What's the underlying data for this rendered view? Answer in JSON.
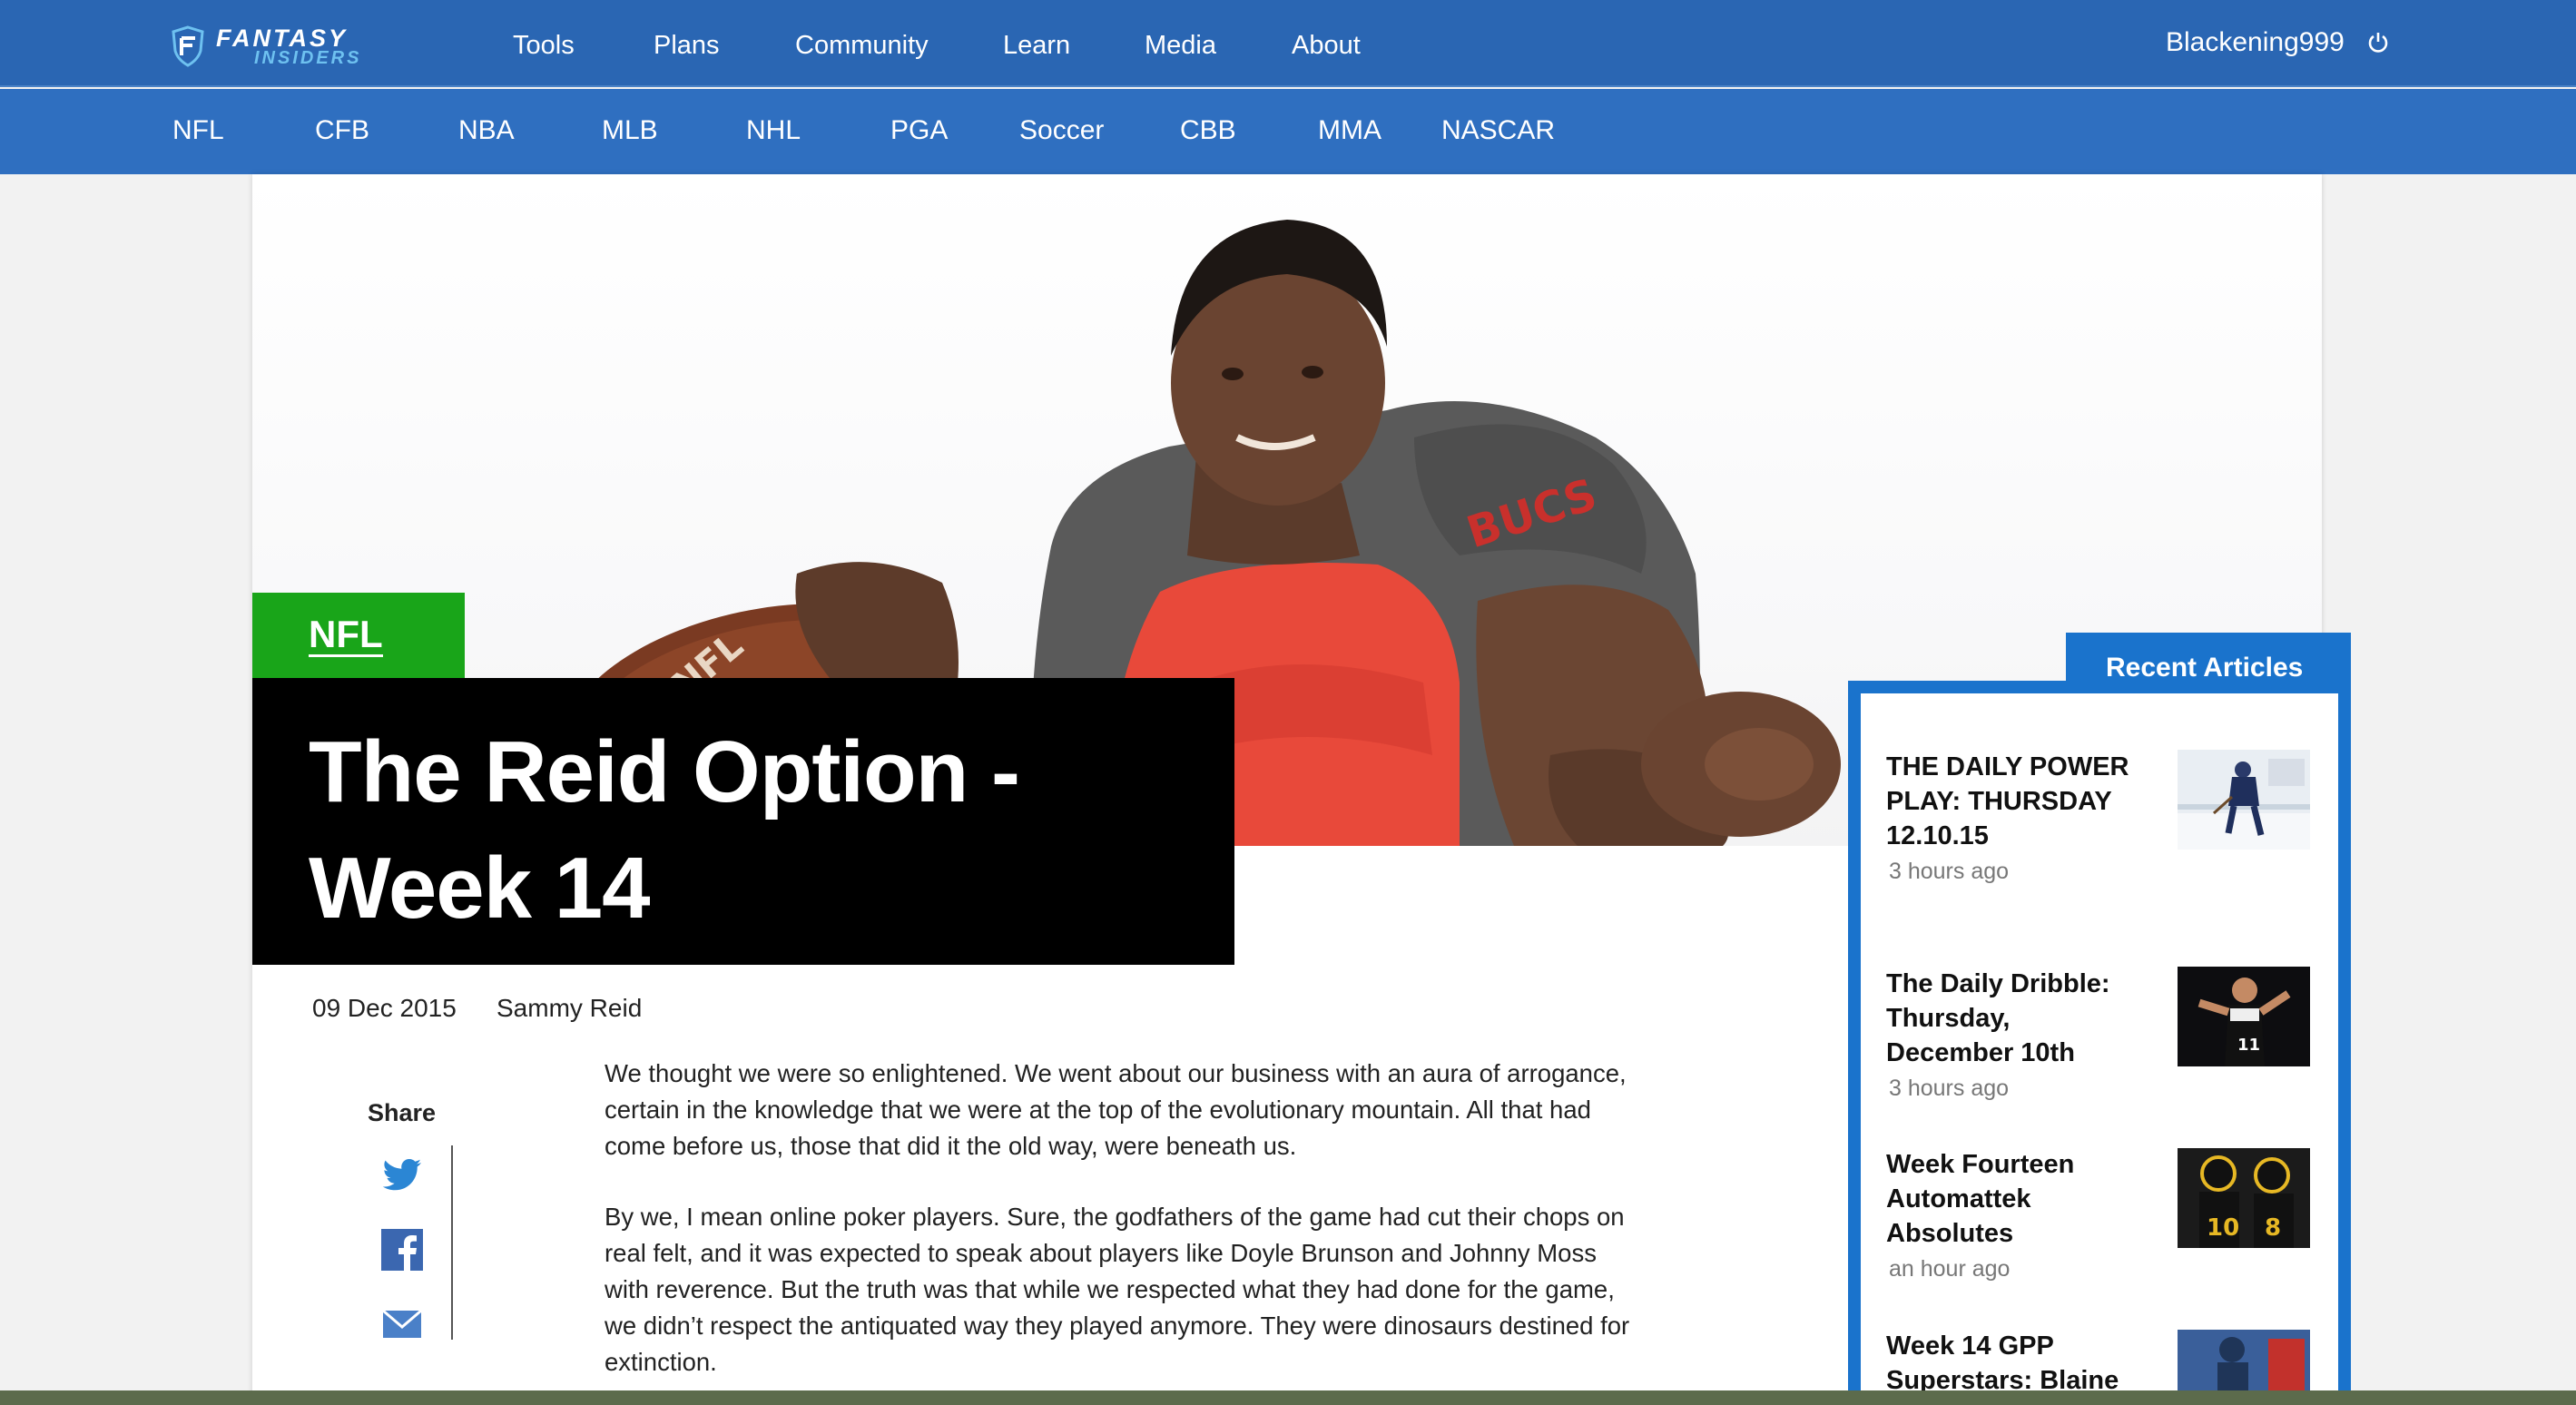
{
  "header": {
    "logo_line1": "FANTASY",
    "logo_line2": "INSIDERS",
    "nav": [
      "Tools",
      "Plans",
      "Community",
      "Learn",
      "Media",
      "About"
    ],
    "username": "Blackening999"
  },
  "sports_nav": [
    "NFL",
    "CFB",
    "NBA",
    "MLB",
    "NHL",
    "PGA",
    "Soccer",
    "CBB",
    "MMA",
    "NASCAR"
  ],
  "article": {
    "category": "NFL",
    "title": "The Reid Option - Week 14",
    "date": "09 Dec 2015",
    "author": "Sammy Reid",
    "share_label": "Share",
    "paragraphs": [
      "We thought we were so enlightened. We went about our business with an aura of arrogance, certain in the knowledge that we were at the top of the evolutionary mountain. All that had come before us, those that did it the old way, were beneath us.",
      "By we, I mean online poker players. Sure, the godfathers of the game had cut their chops on real felt, and it was expected to speak about players like Doyle Brunson and Johnny Moss with reverence. But the truth was that while we respected what they had done for the game, we didn’t respect the antiquated way they played anymore. They were dinosaurs destined for extinction."
    ]
  },
  "recent": {
    "heading": "Recent Articles",
    "items": [
      {
        "title": "THE DAILY POWER PLAY: THURSDAY 12.10.15",
        "time": "3 hours ago"
      },
      {
        "title": "The Daily Dribble: Thursday, December 10th",
        "time": "3 hours ago"
      },
      {
        "title": "Week Fourteen Automattek Absolutes",
        "time": "an hour ago"
      },
      {
        "title": "Week 14 GPP Superstars: Blaine",
        "time": ""
      }
    ]
  },
  "colors": {
    "nav_bg": "#2a66b3",
    "sport_bar_bg": "#2f6fc0",
    "category_green": "#19a519",
    "recent_blue": "#1a73cc"
  }
}
